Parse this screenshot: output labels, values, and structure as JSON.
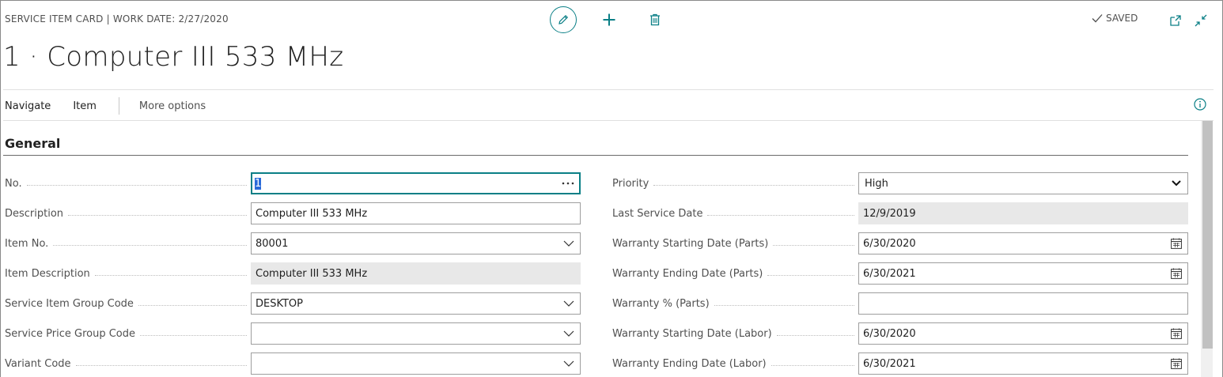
{
  "header": {
    "caption": "SERVICE ITEM CARD | WORK DATE: 2/27/2020",
    "title": "1 · Computer III 533 MHz",
    "saved_label": "SAVED",
    "icons": [
      "edit-icon",
      "add-icon",
      "delete-icon",
      "checkmark-icon",
      "open-new-window-icon",
      "collapse-icon"
    ]
  },
  "actionbar": {
    "navigate": "Navigate",
    "item": "Item",
    "more_options": "More options"
  },
  "section": {
    "title": "General"
  },
  "left_fields": [
    {
      "label": "No.",
      "value": "1",
      "control": "lookup"
    },
    {
      "label": "Description",
      "value": "Computer III 533 MHz",
      "control": "text"
    },
    {
      "label": "Item No.",
      "value": "80001",
      "control": "dropdown"
    },
    {
      "label": "Item Description",
      "value": "Computer III 533 MHz",
      "control": "readonly"
    },
    {
      "label": "Service Item Group Code",
      "value": "DESKTOP",
      "control": "dropdown"
    },
    {
      "label": "Service Price Group Code",
      "value": "",
      "control": "dropdown"
    },
    {
      "label": "Variant Code",
      "value": "",
      "control": "dropdown"
    }
  ],
  "right_fields": [
    {
      "label": "Priority",
      "value": "High",
      "control": "select"
    },
    {
      "label": "Last Service Date",
      "value": "12/9/2019",
      "control": "readonly"
    },
    {
      "label": "Warranty Starting Date (Parts)",
      "value": "6/30/2020",
      "control": "date"
    },
    {
      "label": "Warranty Ending Date (Parts)",
      "value": "6/30/2021",
      "control": "date"
    },
    {
      "label": "Warranty % (Parts)",
      "value": "",
      "control": "text"
    },
    {
      "label": "Warranty Starting Date (Labor)",
      "value": "6/30/2020",
      "control": "date"
    },
    {
      "label": "Warranty Ending Date (Labor)",
      "value": "6/30/2021",
      "control": "date"
    }
  ],
  "colors": {
    "accent": "#0a7f86",
    "readonly_bg": "#e8e8e8",
    "selection": "#2a6ad9"
  }
}
